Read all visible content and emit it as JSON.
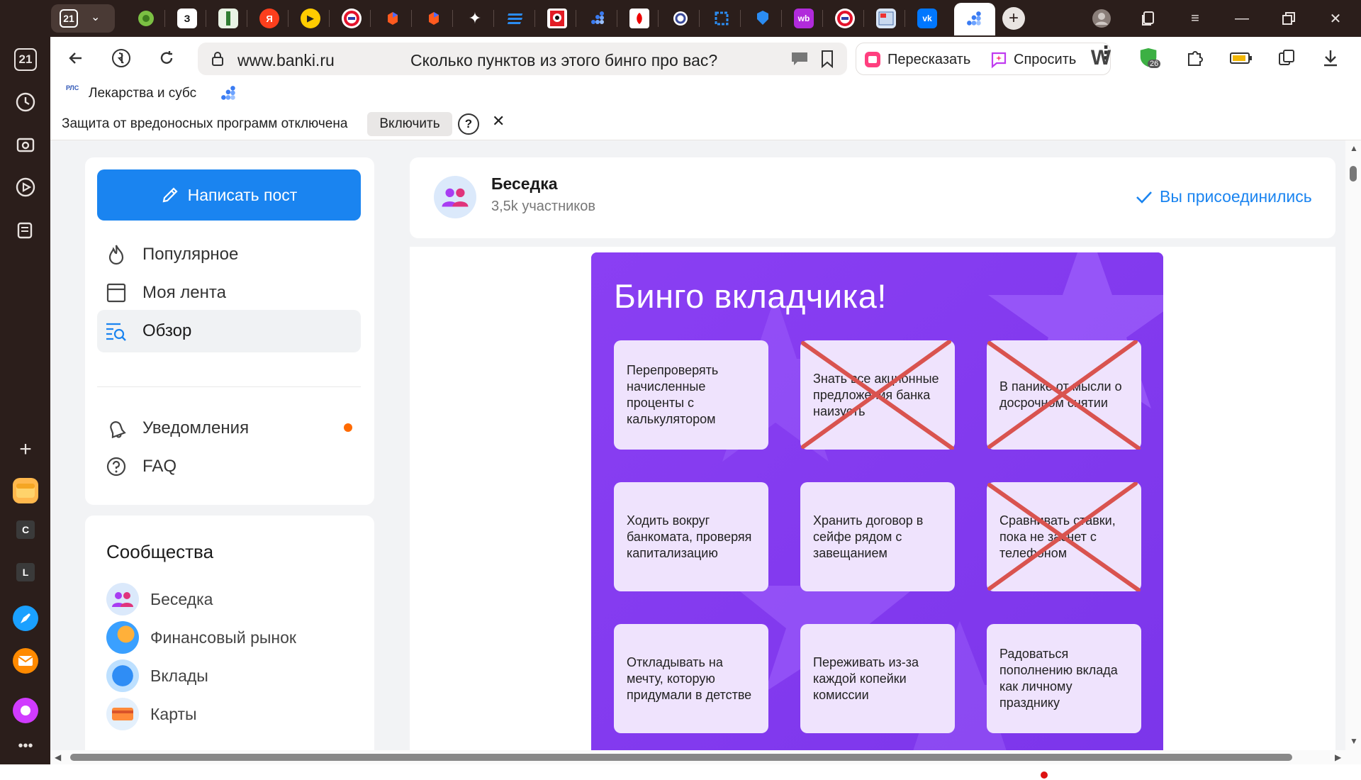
{
  "tabs": {
    "count": "21",
    "favicons": [
      "green-circle-tab-icon",
      "zv-tab-icon",
      "book-tab-icon",
      "yandex-tab-icon",
      "play-tab-icon",
      "ring-tab-icon",
      "cube-tab-icon",
      "cube2-tab-icon",
      "sparkle-tab-icon",
      "lines-tab-icon",
      "face-tab-icon",
      "dots-tab-icon",
      "red-square-tab-icon",
      "circle-tab-icon",
      "crop-tab-icon",
      "heart-tab-icon",
      "wb-tab-icon",
      "ring2-tab-icon",
      "image-tab-icon",
      "vk-tab-icon"
    ],
    "wb_label": "wb",
    "vk_label": "vk"
  },
  "rail": {
    "tab_count": "21",
    "apps": [
      "C",
      "L"
    ]
  },
  "address_bar": {
    "domain": "www.banki.ru",
    "page_title": "Сколько пунктов из этого бинго про вас?"
  },
  "ai_actions": {
    "retell": "Пересказать",
    "ask": "Спросить"
  },
  "extensions": {
    "badge_count": "26"
  },
  "bookmarks": {
    "rls_logo": "РЛС",
    "rls_label": "Лекарства и субс"
  },
  "protection": {
    "message": "Защита от вредоносных программ отключена",
    "enable": "Включить",
    "help": "?"
  },
  "sidebar": {
    "write_post": "Написать пост",
    "nav": [
      {
        "label": "Популярное"
      },
      {
        "label": "Моя лента"
      },
      {
        "label": "Обзор"
      },
      {
        "label": "Уведомления"
      },
      {
        "label": "FAQ"
      }
    ],
    "communities_title": "Сообщества",
    "communities": [
      {
        "label": "Беседка"
      },
      {
        "label": "Финансовый рынок"
      },
      {
        "label": "Вклады"
      },
      {
        "label": "Карты"
      }
    ]
  },
  "group": {
    "name": "Беседка",
    "members": "3,5k участников",
    "joined": "Вы присоединились"
  },
  "bingo": {
    "title": "Бинго вкладчика!",
    "cells": [
      {
        "text": "Перепроверять начисленные проценты с калькулятором",
        "crossed": false
      },
      {
        "text": "Знать все акционные предложения банка наизусть",
        "crossed": true
      },
      {
        "text": "В панике от мысли о досрочном снятии",
        "crossed": true
      },
      {
        "text": "Ходить вокруг банкомата, проверяя капитализацию",
        "crossed": false
      },
      {
        "text": "Хранить договор в сейфе рядом с завещанием",
        "crossed": false
      },
      {
        "text": "Сравнивать ставки, пока не заснет с телефоном",
        "crossed": true
      },
      {
        "text": "Откладывать на мечту, которую придумали в детстве",
        "crossed": false
      },
      {
        "text": "Переживать из-за каждой копейки комиссии",
        "crossed": false
      },
      {
        "text": "Радоваться пополнению вклада как личному празднику",
        "crossed": false
      }
    ]
  },
  "colors": {
    "accent_blue": "#1a84f0",
    "bingo_purple": "#8b3df2",
    "cross_red": "#d9534f",
    "notification_dot": "#ff6a00"
  }
}
